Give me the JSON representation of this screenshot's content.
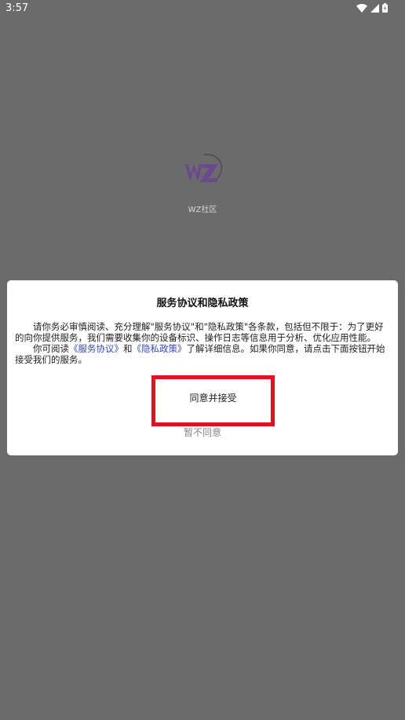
{
  "status_bar": {
    "time": "3:57",
    "icons": [
      "wifi-icon",
      "signal-icon",
      "battery-icon"
    ]
  },
  "splash": {
    "logo_icon": "wz-logo-icon",
    "app_name": "WZ社区"
  },
  "dialog": {
    "title": "服务协议和隐私政策",
    "paragraph1": "请你务必审慎阅读、充分理解\"服务协议\"和\"隐私政策\"各条款，包括但不限于：为了更好的向你提供服务，我们需要收集你的设备标识、操作日志等信息用于分析、优化应用性能。",
    "p2_prefix": "你可阅读",
    "link_service": "《服务协议》",
    "p2_and": "和",
    "link_privacy": "《隐私政策》",
    "p2_suffix": "了解详细信息。如果你同意，请点击下面按钮开始接受我们的服务。",
    "agree_label": "同意并接受",
    "disagree_label": "暂不同意"
  },
  "colors": {
    "overlay_background": "#6b6b6b",
    "dialog_background": "#ffffff",
    "link": "#3747c9",
    "highlight_border": "#e0141e",
    "logo_purple": "#6a4a8c"
  }
}
